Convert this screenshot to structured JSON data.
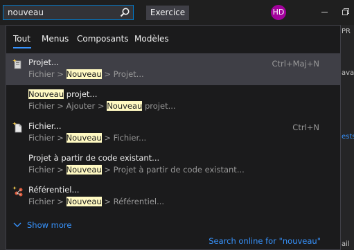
{
  "search": {
    "value": "nouveau"
  },
  "toolbar": {
    "exercice_label": "Exercice"
  },
  "user": {
    "initials": "HD",
    "avatar_color": "#a2029c"
  },
  "tabs": [
    {
      "label": "Tout",
      "active": true
    },
    {
      "label": "Menus"
    },
    {
      "label": "Composants"
    },
    {
      "label": "Modèles"
    }
  ],
  "results": [
    {
      "icon": "new-project-icon",
      "title_pre": "Projet...",
      "path_pre": "Fichier > ",
      "path_hl": "Nouveau",
      "path_post": " > Projet...",
      "shortcut": "Ctrl+Maj+N"
    },
    {
      "icon": "",
      "title_hl": "Nouveau",
      "title_post": " projet...",
      "path_pre": "Fichier > Ajouter > ",
      "path_hl": "Nouveau",
      "path_post": " projet..."
    },
    {
      "icon": "new-file-icon",
      "title_pre": "Fichier...",
      "path_pre": "Fichier > ",
      "path_hl": "Nouveau",
      "path_post": " > Fichier...",
      "shortcut": "Ctrl+N"
    },
    {
      "icon": "",
      "title_pre": "Projet à partir de code existant...",
      "path_pre": "Fichier > ",
      "path_hl": "Nouveau",
      "path_post": " > Projet à partir de code existant..."
    },
    {
      "icon": "repository-icon",
      "title_pre": "Référentiel...",
      "path_pre": "Fichier > ",
      "path_hl": "Nouveau",
      "path_post": " > Référentiel..."
    }
  ],
  "show_more_label": "Show more",
  "search_online_label": "Search online for \"nouveau\"",
  "background_strip": {
    "top": "PR",
    "mid1": "ava",
    "mid2": "ests",
    "bottom": "ail"
  },
  "colors": {
    "accent": "#3794ff",
    "highlight": "#fff9c2",
    "selected_row": "#3f3f46"
  }
}
